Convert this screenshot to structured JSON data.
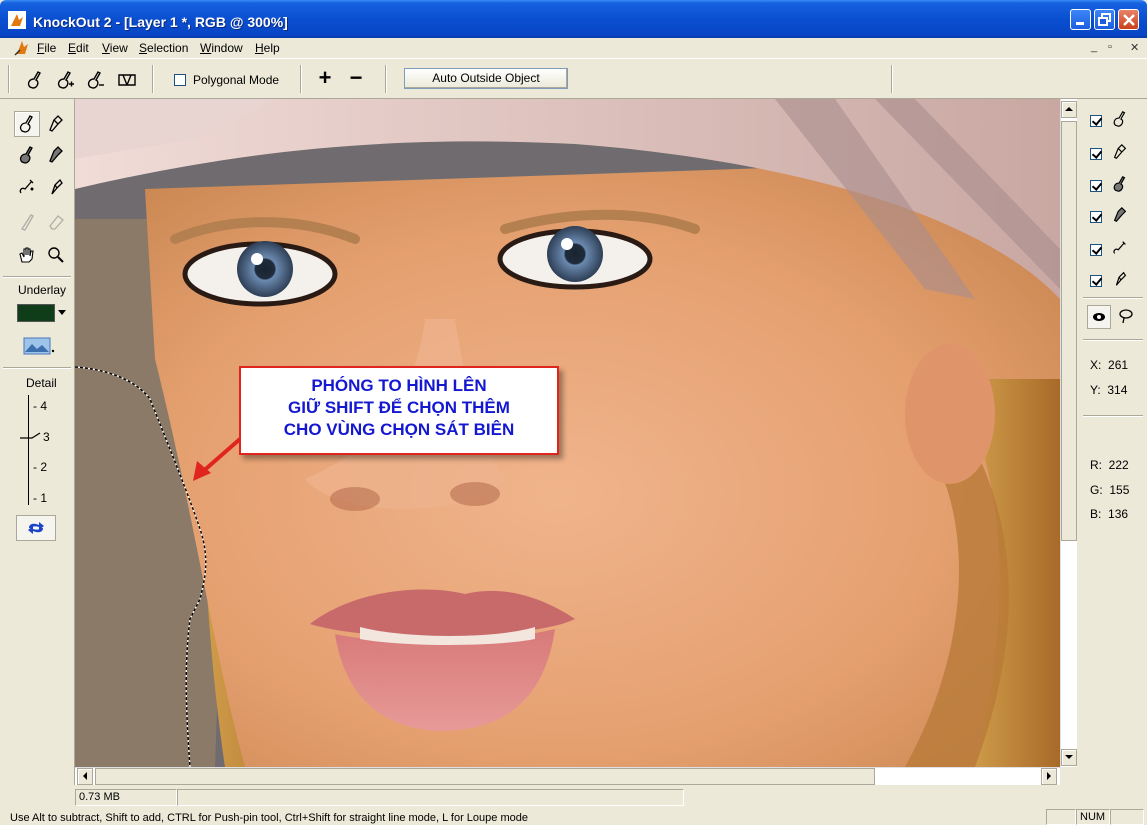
{
  "window": {
    "title": "KnockOut 2 - [Layer 1 *, RGB @ 300%]"
  },
  "menu": {
    "items": [
      "File",
      "Edit",
      "View",
      "Selection",
      "Window",
      "Help"
    ]
  },
  "toolbar": {
    "polygonal_mode_label": "Polygonal Mode",
    "auto_outside_label": "Auto Outside Object",
    "plus": "+",
    "minus": "−"
  },
  "toolbox": {
    "underlay_label": "Underlay",
    "underlay_color": "#0f3d1a",
    "detail_label": "Detail",
    "detail_levels": [
      "4",
      "3",
      "2",
      "1"
    ],
    "detail_selected": "3"
  },
  "right_panel": {
    "x_label": "X:",
    "x_value": "261",
    "y_label": "Y:",
    "y_value": "314",
    "r_label": "R:",
    "r_value": "222",
    "g_label": "G:",
    "g_value": "155",
    "b_label": "B:",
    "b_value": "136"
  },
  "annotation": {
    "line1": "PHÓNG TO HÌNH LÊN",
    "line2": "GIỮ SHIFT ĐỂ CHỌN THÊM",
    "line3": "CHO VÙNG CHỌN SÁT BIÊN"
  },
  "status": {
    "memory": "0.73 MB",
    "hint": "Use Alt to subtract, Shift to add, CTRL for Push-pin tool, Ctrl+Shift for straight line mode, L for Loupe mode",
    "num": "NUM"
  },
  "colors": {
    "title_bar": "#0a4fd1",
    "annotation_text": "#1418d0",
    "annotation_border": "#e0241e"
  }
}
